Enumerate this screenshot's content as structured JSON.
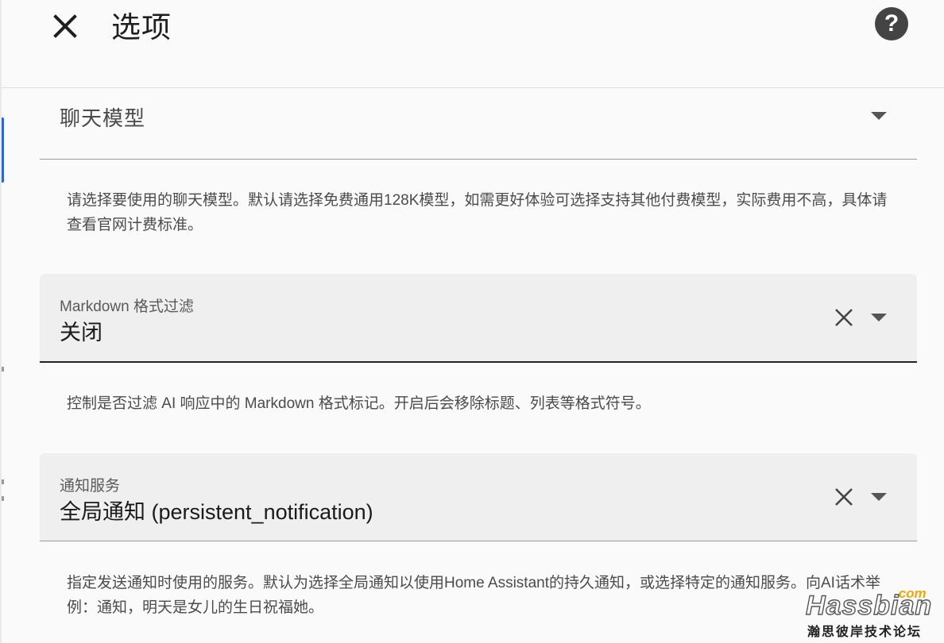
{
  "dialog": {
    "title": "选项",
    "close_icon": "close-icon",
    "help_icon": "help-circle-icon",
    "help_glyph": "?"
  },
  "fields": [
    {
      "label": "聊天模型",
      "value": "",
      "helper": "请选择要使用的聊天模型。默认请选择免费通用128K模型，如需更好体验可选择支持其他付费模型，实际费用不高，具体请查看官网计费标准。"
    },
    {
      "label": "Markdown 格式过滤",
      "value": "关闭",
      "helper": "控制是否过滤 AI 响应中的 Markdown 格式标记。开启后会移除标题、列表等格式符号。"
    },
    {
      "label": "通知服务",
      "value": "全局通知 (persistent_notification)",
      "helper": "指定发送通知时使用的服务。默认为选择全局通知以使用Home Assistant的持久通知，或选择特定的通知服务。向AI话术举例：通知，明天是女儿的生日祝福她。"
    }
  ],
  "watermark": {
    "brand": "Hassbian",
    "tld": ".com",
    "subtitle": "瀚思彼岸技术论坛"
  },
  "colors": {
    "background": "#fafafa",
    "field_fill": "#efefef",
    "accent": "#2a66d6",
    "watermark_tld": "#f0a800"
  }
}
